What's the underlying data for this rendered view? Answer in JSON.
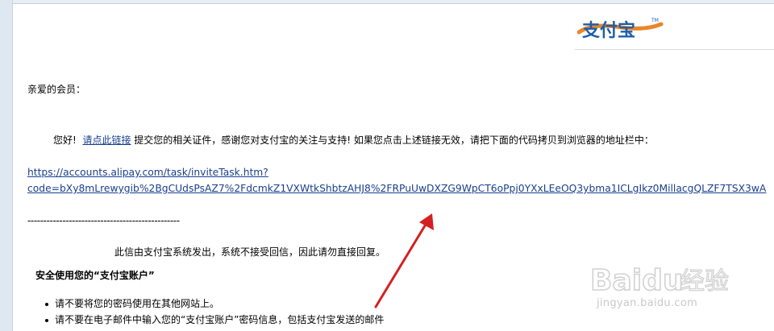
{
  "logo": {
    "text": "支付宝",
    "tm": "TM"
  },
  "greeting": "亲爱的会员：",
  "message": {
    "hello": "您好!",
    "link_text": "请点此链接",
    "rest": "提交您的相关证件，感谢您对支付宝的关注与支持! 如果您点击上述链接无效，请把下面的代码拷贝到浏览器的地址栏中："
  },
  "url": {
    "line1": "https://accounts.alipay.com/task/inviteTask.htm?",
    "line2": "code=bXy8mLrewygib%2BgCUdsPsAZ7%2FdcmkZ1VXWtkShbtzAHJ8%2FRPuUwDXZG9WpCT6oPpj0YXxLEeOQ3ybma1ICLgIkz0MillacgQLZF7TSX3wA"
  },
  "divider": "------------------------------------------------",
  "notice": "此信由支付宝系统发出，系统不接受回信，因此请勿直接回复。",
  "security": {
    "heading": "安全使用您的“支付宝账户”",
    "items": [
      "请不要将您的密码使用在其他网站上。",
      "请不要在电子邮件中输入您的“支付宝账户”密码信息，包括支付宝发送的邮件"
    ]
  },
  "watermark": {
    "brand": "Baidu",
    "cn": "经验",
    "sub": "jingyan.baidu.com"
  },
  "colors": {
    "link": "#1a3f8f",
    "arrow": "#d42020",
    "logo_blue": "#1e5ea8",
    "logo_orange": "#e8862a"
  }
}
